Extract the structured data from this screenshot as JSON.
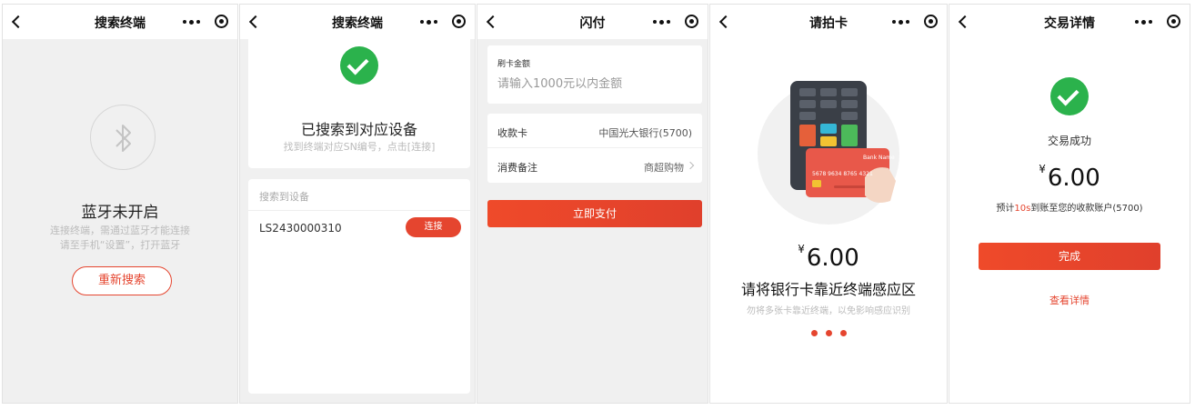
{
  "screens": [
    {
      "nav_title": "搜索终端",
      "status_title": "蓝牙未开启",
      "hint_line1": "连接终端，需通过蓝牙才能连接",
      "hint_line2": "请至手机“设置”，打开蓝牙",
      "action_label": "重新搜索",
      "icon": "bluetooth-icon"
    },
    {
      "nav_title": "搜索终端",
      "status_title": "已搜索到对应设备",
      "status_sub": "找到终端对应SN编号，点击[连接]",
      "list_header": "搜索到设备",
      "devices": [
        {
          "sn": "LS2430000310",
          "action_label": "连接"
        }
      ]
    },
    {
      "nav_title": "闪付",
      "amount_label": "刷卡金额",
      "amount_placeholder": "请输入1000元以内金额",
      "rows": [
        {
          "label": "收款卡",
          "value": "中国光大银行(5700)"
        },
        {
          "label": "消费备注",
          "value": "商超购物"
        }
      ],
      "pay_label": "立即支付"
    },
    {
      "nav_title": "请拍卡",
      "currency": "¥",
      "amount": "6.00",
      "instruction": "请将银行卡靠近终端感应区",
      "instruction_sub": "勿将多张卡靠近终端，以免影响感应识别",
      "card": {
        "bank_name": "Bank Name",
        "number": "5678 9634 8765 4321"
      },
      "progress_dots": 3
    },
    {
      "nav_title": "交易详情",
      "result": "交易成功",
      "currency": "¥",
      "amount": "6.00",
      "expect_prefix": "预计",
      "expect_highlight": "10s",
      "expect_suffix": "到账至您的收款账户(5700)",
      "done_label": "完成",
      "detail_label": "查看详情"
    }
  ],
  "colors": {
    "accent": "#e5452f",
    "success": "#2bb24c",
    "page_bg": "#f0f0f0"
  }
}
